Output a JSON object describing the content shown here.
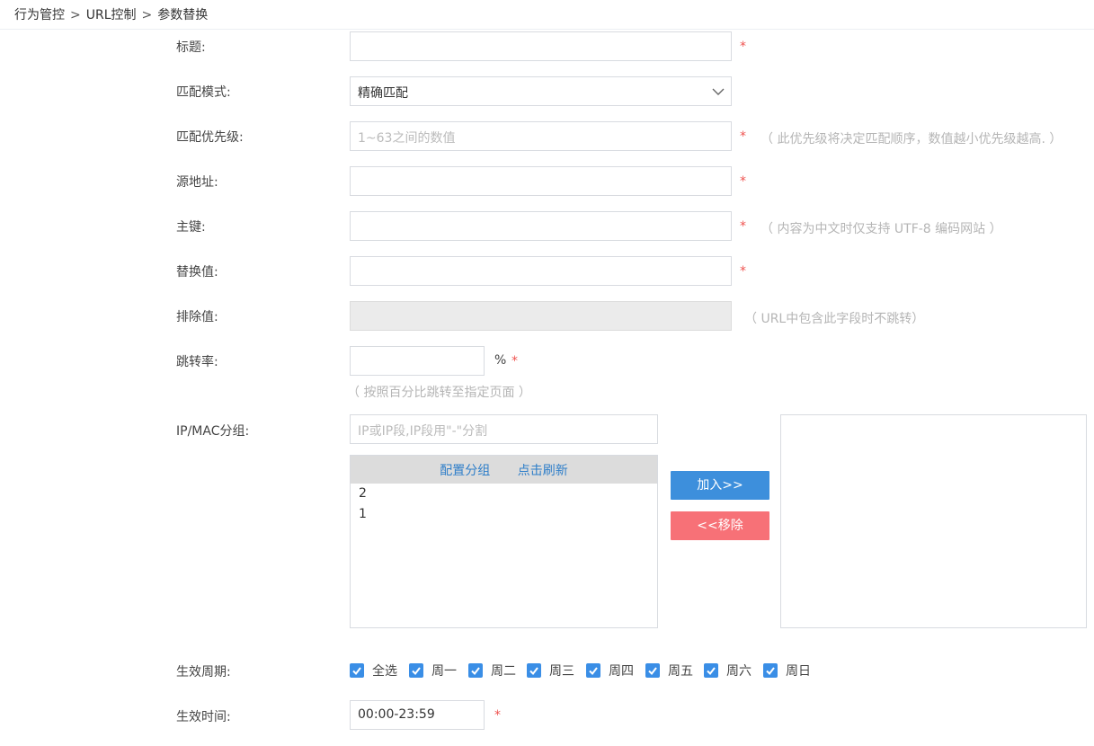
{
  "breadcrumb": {
    "items": [
      "行为管控",
      "URL控制",
      "参数替换"
    ],
    "separator": ">"
  },
  "form": {
    "title": {
      "label": "标题:",
      "value": "",
      "required": "*"
    },
    "match_mode": {
      "label": "匹配模式:",
      "value": "精确匹配"
    },
    "priority": {
      "label": "匹配优先级:",
      "placeholder": "1~63之间的数值",
      "required": "*",
      "hint": "（ 此优先级将决定匹配顺序，数值越小优先级越高. ）"
    },
    "source": {
      "label": "源地址:",
      "value": "",
      "required": "*"
    },
    "key": {
      "label": "主键:",
      "value": "",
      "required": "*",
      "hint": "（ 内容为中文时仅支持 UTF-8 编码网站 ）"
    },
    "replace": {
      "label": "替换值:",
      "value": "",
      "required": "*"
    },
    "exclude": {
      "label": "排除值:",
      "value": "",
      "hint": "（ URL中包含此字段时不跳转）"
    },
    "jump_rate": {
      "label": "跳转率:",
      "value": "",
      "unit": "%",
      "required": "*",
      "hint": "（ 按照百分比跳转至指定页面 ）"
    },
    "ipmac": {
      "label": "IP/MAC分组:",
      "placeholder": "IP或IP段,IP段用\"-\"分割",
      "config_link": "配置分组",
      "refresh_link": "点击刷新",
      "items": [
        "2",
        "1"
      ],
      "add_button": "加入>>",
      "remove_button": "<<移除"
    },
    "period": {
      "label": "生效周期:",
      "options": [
        {
          "label": "全选",
          "checked": true
        },
        {
          "label": "周一",
          "checked": true
        },
        {
          "label": "周二",
          "checked": true
        },
        {
          "label": "周三",
          "checked": true
        },
        {
          "label": "周四",
          "checked": true
        },
        {
          "label": "周五",
          "checked": true
        },
        {
          "label": "周六",
          "checked": true
        },
        {
          "label": "周日",
          "checked": true
        }
      ]
    },
    "time": {
      "label": "生效时间:",
      "value": "00:00-23:59",
      "required": "*"
    }
  },
  "colors": {
    "accent": "#3d8fdc",
    "danger": "#f77177",
    "required": "#ef5350",
    "checkbox": "#3a8ee6"
  }
}
